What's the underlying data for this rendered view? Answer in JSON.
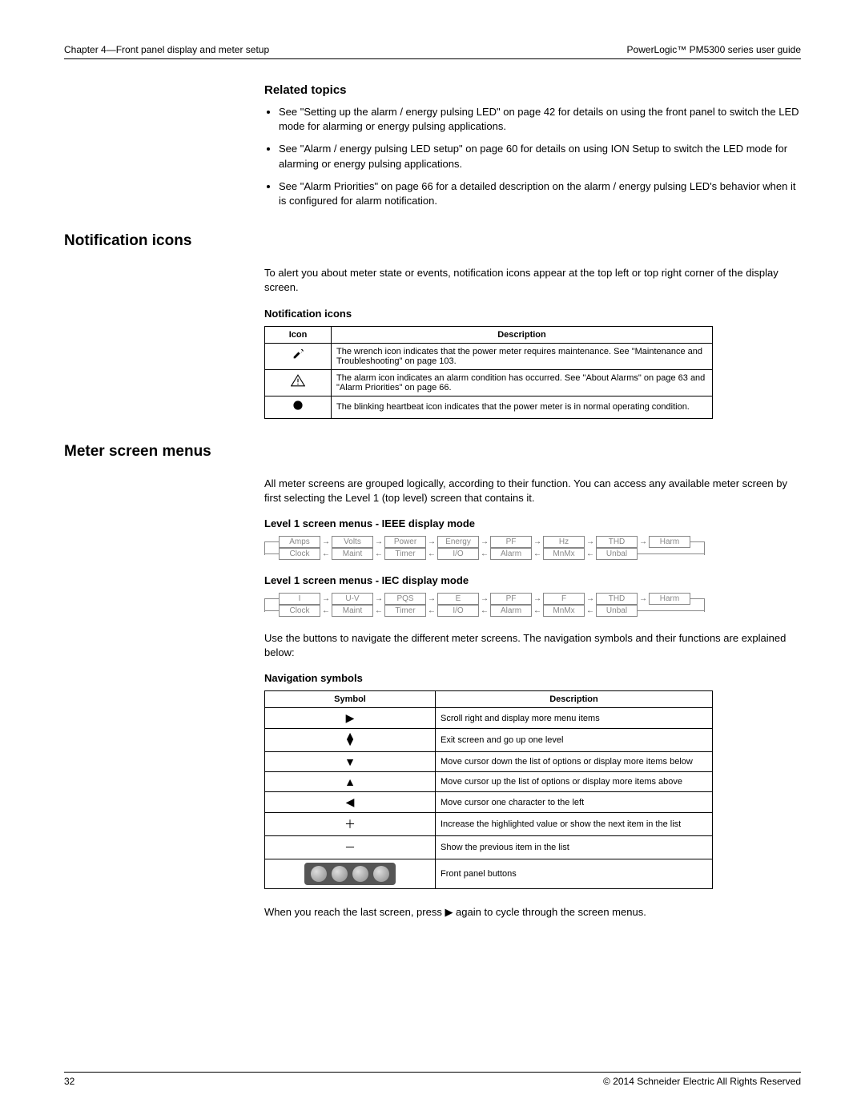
{
  "header": {
    "left": "Chapter 4—Front panel display and meter setup",
    "right": "PowerLogic™ PM5300 series user guide"
  },
  "related": {
    "heading": "Related topics",
    "items": [
      "See \"Setting up the alarm / energy pulsing LED\" on page 42 for details on using the front panel to switch the LED mode for alarming or energy pulsing applications.",
      "See \"Alarm / energy pulsing LED setup\" on page 60 for details on using ION Setup to switch the LED mode for alarming or energy pulsing applications.",
      "See \"Alarm Priorities\" on page 66 for a detailed description on the alarm / energy pulsing LED's behavior when it is configured for alarm notification."
    ]
  },
  "notif": {
    "heading": "Notification icons",
    "intro": "To alert you about meter state or events, notification icons appear at the top left or top right corner of the display screen.",
    "table_caption": "Notification icons",
    "col_icon": "Icon",
    "col_desc": "Description",
    "rows": [
      {
        "icon": "wrench",
        "desc": "The wrench icon indicates that the power meter requires maintenance. See \"Maintenance and Troubleshooting\" on page 103."
      },
      {
        "icon": "alarm",
        "desc": "The alarm icon indicates an alarm condition has occurred. See \"About Alarms\" on page 63 and \"Alarm Priorities\" on page 66."
      },
      {
        "icon": "heartbeat",
        "desc": "The blinking heartbeat icon indicates that the power meter is in normal operating condition."
      }
    ]
  },
  "menus": {
    "heading": "Meter screen menus",
    "intro": "All meter screens are grouped logically, according to their function. You can access any available meter screen by first selecting the Level 1 (top level) screen that contains it.",
    "ieee_caption": "Level 1 screen menus - IEEE display mode",
    "ieee_top": [
      "Amps",
      "Volts",
      "Power",
      "Energy",
      "PF",
      "Hz",
      "THD",
      "Harm"
    ],
    "ieee_bot": [
      "Clock",
      "Maint",
      "Timer",
      "I/O",
      "Alarm",
      "MnMx",
      "Unbal"
    ],
    "iec_caption": "Level 1 screen menus - IEC display mode",
    "iec_top": [
      "I",
      "U-V",
      "PQS",
      "E",
      "PF",
      "F",
      "THD",
      "Harm"
    ],
    "iec_bot": [
      "Clock",
      "Maint",
      "Timer",
      "I/O",
      "Alarm",
      "MnMx",
      "Unbal"
    ],
    "nav_intro": "Use the buttons to navigate the different meter screens. The navigation symbols and their functions are explained below:",
    "nav_caption": "Navigation symbols",
    "nav_col_sym": "Symbol",
    "nav_col_desc": "Description",
    "nav_rows": [
      {
        "sym": "▶",
        "desc": "Scroll right and display more menu items"
      },
      {
        "sym": "up-exit",
        "desc": "Exit screen and go up one level"
      },
      {
        "sym": "▼",
        "desc": "Move cursor down the list of options or display more items below"
      },
      {
        "sym": "▲",
        "desc": "Move cursor up the list of options or display more items above"
      },
      {
        "sym": "◀",
        "desc": "Move cursor one character to the left"
      },
      {
        "sym": "＋",
        "desc": "Increase the highlighted value or show the next item in the list"
      },
      {
        "sym": "－",
        "desc": "Show the previous item in the list"
      },
      {
        "sym": "buttons",
        "desc": "Front panel buttons"
      }
    ],
    "outro": "When you reach the last screen, press ▶ again to cycle through the screen menus."
  },
  "footer": {
    "page": "32",
    "copyright": "© 2014 Schneider Electric All Rights Reserved"
  }
}
